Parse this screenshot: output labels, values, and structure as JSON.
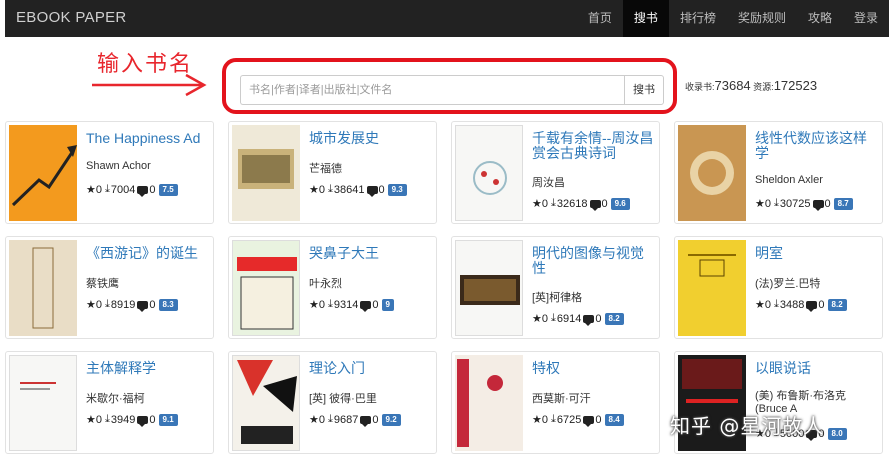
{
  "brand": "EBOOK   PAPER",
  "nav": [
    {
      "label": "首页",
      "active": false
    },
    {
      "label": "搜书",
      "active": true
    },
    {
      "label": "排行榜",
      "active": false
    },
    {
      "label": "奖励规则",
      "active": false
    },
    {
      "label": "攻略",
      "active": false
    },
    {
      "label": "登录",
      "active": false
    }
  ],
  "annotation": "输入书名",
  "search": {
    "placeholder": "书名|作者|译者|出版社|文件名",
    "button": "搜书"
  },
  "stats": {
    "books_label": "收录书:",
    "books": "73684",
    "resources_label": " 资源:",
    "resources": "172523"
  },
  "books": [
    {
      "title": "The Happiness Ad",
      "author": "Shawn Achor",
      "stars": "★0",
      "downloads": "7004",
      "comments": "0",
      "rating": "7.5"
    },
    {
      "title": "城市发展史",
      "author": "芒福德",
      "stars": "★0",
      "downloads": "38641",
      "comments": "0",
      "rating": "9.3"
    },
    {
      "title": "千载有余情--周汝昌赏会古典诗词",
      "author": "周汝昌",
      "stars": "★0",
      "downloads": "32618",
      "comments": "0",
      "rating": "9.6"
    },
    {
      "title": "线性代数应该这样学",
      "author": "Sheldon Axler",
      "stars": "★0",
      "downloads": "30725",
      "comments": "0",
      "rating": "8.7"
    },
    {
      "title": "《西游记》的诞生",
      "author": "蔡铁鹰",
      "stars": "★0",
      "downloads": "8919",
      "comments": "0",
      "rating": "8.3"
    },
    {
      "title": "哭鼻子大王",
      "author": "叶永烈",
      "stars": "★0",
      "downloads": "9314",
      "comments": "0",
      "rating": "9"
    },
    {
      "title": "明代的图像与视觉性",
      "author": "[英]柯律格",
      "stars": "★0",
      "downloads": "6914",
      "comments": "0",
      "rating": "8.2"
    },
    {
      "title": "明室",
      "author": "(法)罗兰.巴特",
      "stars": "★0",
      "downloads": "3488",
      "comments": "0",
      "rating": "8.2"
    },
    {
      "title": "主体解释学",
      "author": "米歇尔·福柯",
      "stars": "★0",
      "downloads": "3949",
      "comments": "0",
      "rating": "9.1"
    },
    {
      "title": "理论入门",
      "author": "[英] 彼得·巴里",
      "stars": "★0",
      "downloads": "9687",
      "comments": "0",
      "rating": "9.2"
    },
    {
      "title": "特权",
      "author": "西莫斯·可汗",
      "stars": "★0",
      "downloads": "6725",
      "comments": "0",
      "rating": "8.4"
    },
    {
      "title": "以眼说话",
      "author": "(美) 布鲁斯·布洛克 (Bruce A",
      "stars": "★0",
      "downloads": "5000",
      "comments": "0",
      "rating": "8.0"
    }
  ],
  "watermark": "知乎 @星河故人"
}
